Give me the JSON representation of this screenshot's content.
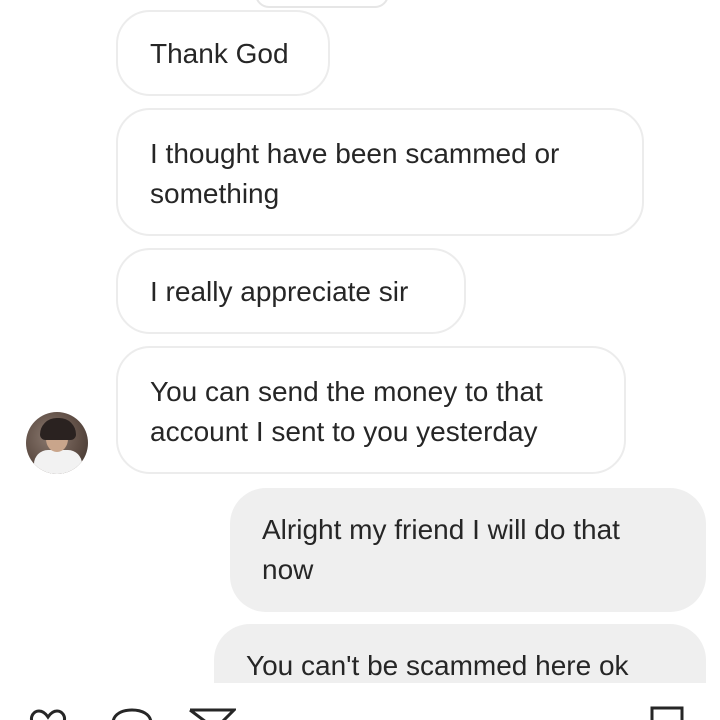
{
  "conversation": {
    "messages": [
      {
        "direction": "incoming",
        "lines": [
          "Thank God"
        ]
      },
      {
        "direction": "incoming",
        "lines": [
          "I thought have been scammed or",
          "something"
        ]
      },
      {
        "direction": "incoming",
        "lines": [
          "I really appreciate sir"
        ]
      },
      {
        "direction": "incoming",
        "lines": [
          "You can send the money to that",
          "account I sent to you yesterday"
        ]
      },
      {
        "direction": "outgoing",
        "lines": [
          "Alright my friend I will do that",
          "now"
        ]
      },
      {
        "direction": "outgoing",
        "lines": [
          "You can't be scammed here ok"
        ]
      }
    ]
  },
  "icons": {
    "like": "heart-icon",
    "comment": "comment-icon",
    "share": "send-icon",
    "save": "bookmark-icon"
  },
  "colors": {
    "incoming_bubble": "#ffffff",
    "incoming_border": "#ececec",
    "outgoing_bubble": "#efefef",
    "text": "#262626"
  }
}
